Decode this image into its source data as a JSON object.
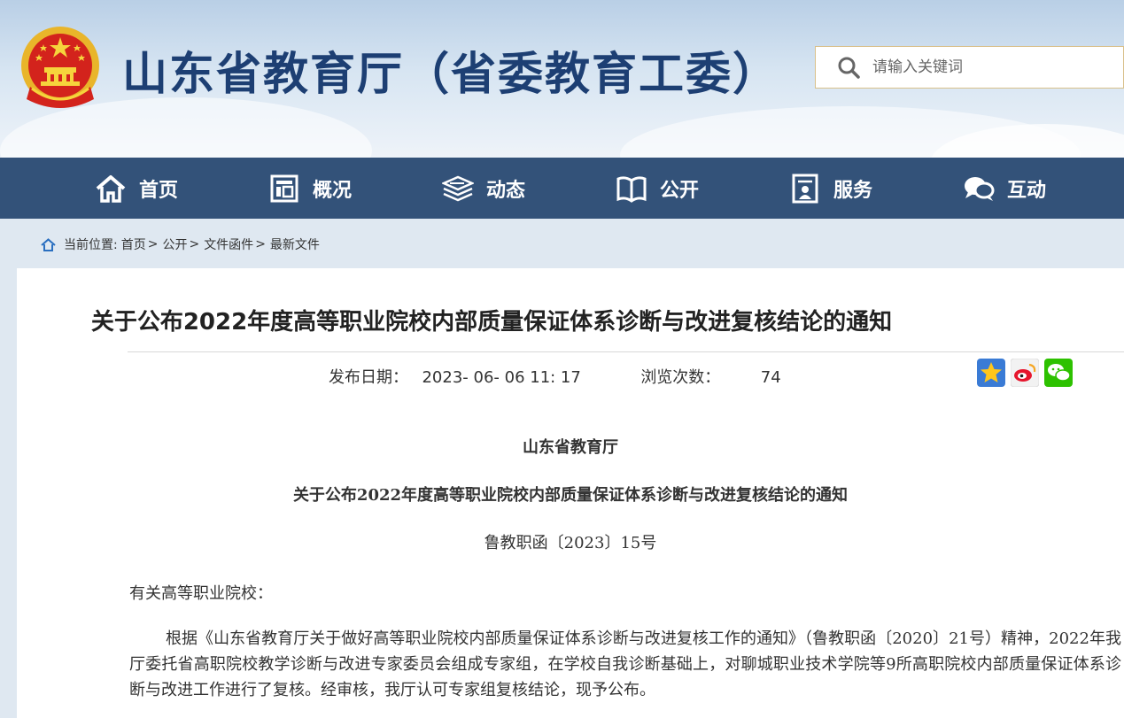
{
  "header": {
    "site_title": "山东省教育厅（省委教育工委）",
    "search": {
      "placeholder": "请输入关键词",
      "value": ""
    }
  },
  "nav": {
    "items": [
      {
        "label": "首页",
        "icon": "home-icon"
      },
      {
        "label": "概况",
        "icon": "overview-icon"
      },
      {
        "label": "动态",
        "icon": "news-stack-icon"
      },
      {
        "label": "公开",
        "icon": "open-book-icon"
      },
      {
        "label": "服务",
        "icon": "service-doc-icon"
      },
      {
        "label": "互动",
        "icon": "chat-bubbles-icon"
      }
    ]
  },
  "breadcrumb": {
    "prefix": "当前位置:",
    "items": [
      "首页",
      "公开",
      "文件函件",
      "最新文件"
    ],
    "separator": ">"
  },
  "article": {
    "title": "关于公布2022年度高等职业院校内部质量保证体系诊断与改进复核结论的通知",
    "meta": {
      "date_label": "发布日期：",
      "date_value": "2023- 06- 06 11: 17",
      "views_label": "浏览次数：",
      "views_value": "74"
    },
    "share": [
      "qzone-star-icon",
      "weibo-icon",
      "wechat-icon"
    ],
    "doc": {
      "issuer": "山东省教育厅",
      "subtitle": "关于公布2022年度高等职业院校内部质量保证体系诊断与改进复核结论的通知",
      "doc_number": "鲁教职函〔2023〕15号",
      "salutation": "有关高等职业院校：",
      "paragraph": "根据《山东省教育厅关于做好高等职业院校内部质量保证体系诊断与改进复核工作的通知》（鲁教职函〔2020〕21号）精神，2022年我厅委托省高职院校教学诊断与改进专家委员会组成专家组，在学校自我诊断基础上，对聊城职业技术学院等9所高职院校内部质量保证体系诊断与改进工作进行了复核。经审核，我厅认可专家组复核结论，现予公布。"
    }
  },
  "colors": {
    "nav_bg": "#335279",
    "title_blue": "#1d3f73",
    "search_border": "#d9c08a"
  }
}
